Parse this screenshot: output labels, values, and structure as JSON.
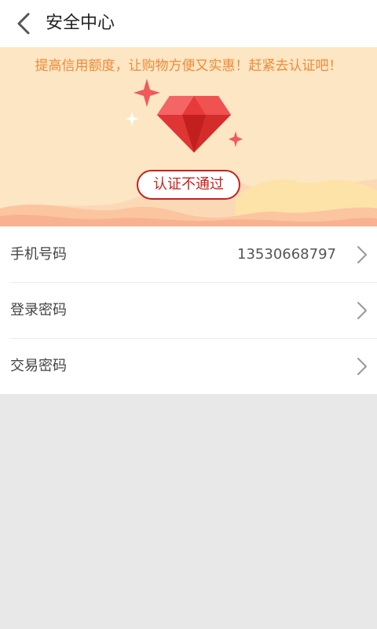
{
  "header": {
    "title": "安全中心",
    "back_icon": "chevron-left-icon"
  },
  "banner": {
    "promo_text": "提高信用额度，让购物方便又实惠！赶紧去认证吧！",
    "status_label": "认证不通过",
    "icons": [
      "diamond-icon",
      "sparkle-icon"
    ],
    "colors": {
      "background": "#fde6c3",
      "promo_text": "#ef8a3a",
      "status_border": "#c9201e",
      "diamond": "#e83a3a"
    }
  },
  "list": {
    "items": [
      {
        "label": "手机号码",
        "value": "13530668797"
      },
      {
        "label": "登录密码",
        "value": ""
      },
      {
        "label": "交易密码",
        "value": ""
      }
    ],
    "chevron_icon": "chevron-right-icon"
  }
}
